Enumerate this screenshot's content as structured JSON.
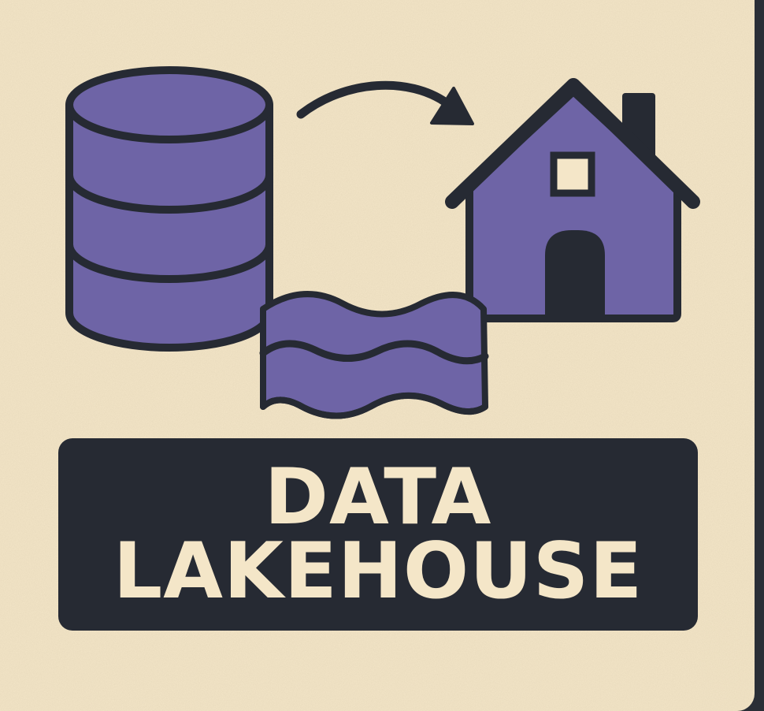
{
  "title": {
    "line1": "DATA",
    "line2": "LAKEHOUSE"
  },
  "icons": [
    "database-icon",
    "arrow-icon",
    "house-icon",
    "lake-waves-icon"
  ],
  "colors": {
    "background": "#f4e6c8",
    "outline": "#262a33",
    "fill": "#6e64a6",
    "banner": "#262a33",
    "banner_text": "#f4e6c8",
    "frame": "#2a2e36"
  }
}
